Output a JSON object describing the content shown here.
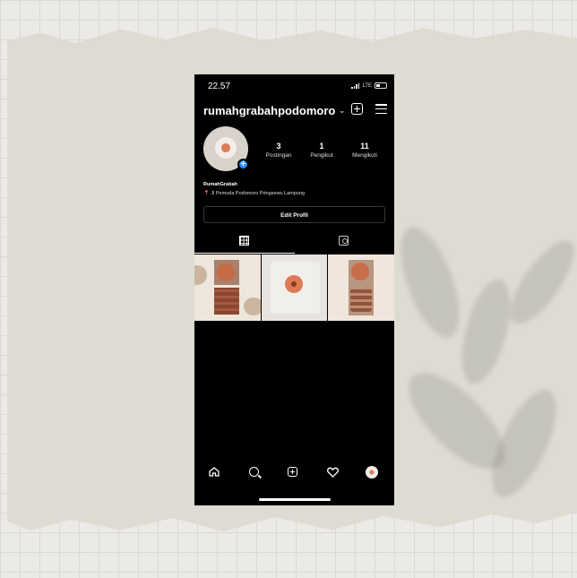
{
  "status": {
    "time": "22.57",
    "network": "LTE"
  },
  "profile": {
    "username": "rumahgrabahpodomoro",
    "display_name": "RumahGrabah",
    "address": "Jl Pemuda Podomoro Pringsewu Lampung",
    "stats": [
      {
        "value": "3",
        "label": "Postingan"
      },
      {
        "value": "1",
        "label": "Pengikut"
      },
      {
        "value": "11",
        "label": "Mengikuti"
      }
    ],
    "edit_label": "Edit Profil"
  },
  "icons": {
    "header": [
      "chevron-down-icon",
      "new-post-icon",
      "menu-icon"
    ],
    "tabs": [
      "grid-icon",
      "tagged-icon"
    ],
    "nav": [
      "home-icon",
      "search-icon",
      "add-post-icon",
      "heart-icon",
      "profile-avatar-icon"
    ]
  },
  "colors": {
    "background": "#000000",
    "accent": "#2d8ef2"
  }
}
